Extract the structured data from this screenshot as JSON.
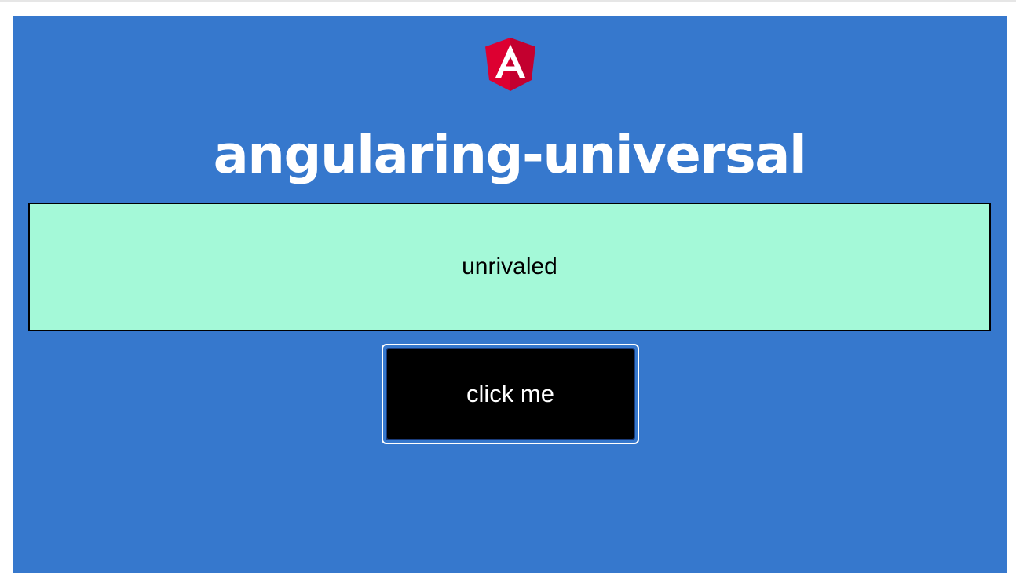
{
  "app": {
    "title": "angularing-universal",
    "logo_icon": "angular-logo-icon",
    "background_color": "#3678cd"
  },
  "word_box": {
    "text": "unrivaled",
    "background_color": "#a4f9d8"
  },
  "action_button": {
    "label": "click me",
    "background_color": "#000000"
  }
}
